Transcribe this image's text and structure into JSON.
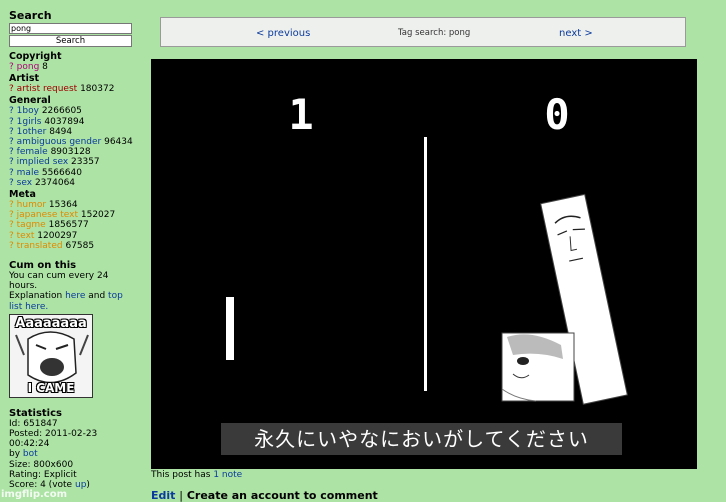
{
  "search": {
    "title": "Search",
    "value": "pong",
    "button_label": "Search"
  },
  "tags": {
    "copyright_title": "Copyright",
    "copyright": [
      {
        "q": "?",
        "name": "pong",
        "count": "8"
      }
    ],
    "artist_title": "Artist",
    "artist": [
      {
        "q": "?",
        "name": "artist request",
        "count": "180372"
      }
    ],
    "general_title": "General",
    "general": [
      {
        "q": "?",
        "name": "1boy",
        "count": "2266605"
      },
      {
        "q": "?",
        "name": "1girls",
        "count": "4037894"
      },
      {
        "q": "?",
        "name": "1other",
        "count": "8494"
      },
      {
        "q": "?",
        "name": "ambiguous gender",
        "count": "96434"
      },
      {
        "q": "?",
        "name": "female",
        "count": "8903128"
      },
      {
        "q": "?",
        "name": "implied sex",
        "count": "23357"
      },
      {
        "q": "?",
        "name": "male",
        "count": "5566640"
      },
      {
        "q": "?",
        "name": "sex",
        "count": "2374064"
      }
    ],
    "meta_title": "Meta",
    "meta": [
      {
        "q": "?",
        "name": "humor",
        "count": "15364"
      },
      {
        "q": "?",
        "name": "japanese text",
        "count": "152027"
      },
      {
        "q": "?",
        "name": "tagme",
        "count": "1856577"
      },
      {
        "q": "?",
        "name": "text",
        "count": "1200297"
      },
      {
        "q": "?",
        "name": "translated",
        "count": "67585"
      }
    ]
  },
  "cum": {
    "title": "Cum on this",
    "line1": "You can cum every 24",
    "line2": "hours.",
    "explanation_prefix": "Explanation",
    "here_link": "here",
    "and_text": "and",
    "top_link": "top",
    "list_link": "list here.",
    "meme_top": "Aaaaaaaa",
    "meme_bottom": "I CAME"
  },
  "statistics": {
    "title": "Statistics",
    "id": "Id: 651847",
    "posted": "Posted: 2011-02-23",
    "time": "00:42:24",
    "by_prefix": "by",
    "by_user": "bot",
    "size": "Size: 800x600",
    "rating": "Rating: Explicit",
    "score_prefix": "Score: 4 (vote",
    "vote_up": "up",
    "score_suffix": ")"
  },
  "nav": {
    "previous": "< previous",
    "center": "Tag search: pong",
    "next": "next >"
  },
  "image": {
    "score_left": "1",
    "score_right": "0",
    "subtitle": "永久にいやなにおいがしてください"
  },
  "notes": {
    "prefix": "This post has",
    "link": "1 note"
  },
  "comment": {
    "edit": "Edit",
    "separator": "|",
    "create": "Create an account to comment"
  },
  "watermark": "imgflip.com"
}
